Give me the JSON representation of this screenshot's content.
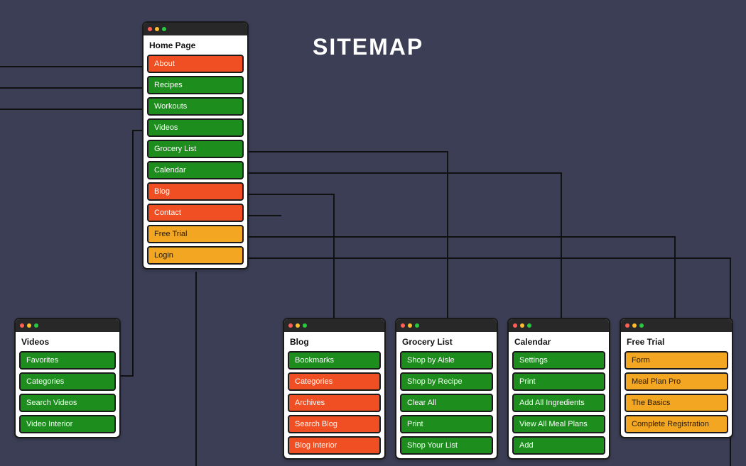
{
  "title": "SITEMAP",
  "colors": {
    "green": "#1d8e1d",
    "orange": "#f04e23",
    "amber": "#f3a621"
  },
  "cards": {
    "home": {
      "header": "Home Page",
      "items": [
        {
          "label": "About",
          "color": "orange"
        },
        {
          "label": "Recipes",
          "color": "green"
        },
        {
          "label": "Workouts",
          "color": "green"
        },
        {
          "label": "Videos",
          "color": "green"
        },
        {
          "label": "Grocery List",
          "color": "green"
        },
        {
          "label": "Calendar",
          "color": "green"
        },
        {
          "label": "Blog",
          "color": "orange"
        },
        {
          "label": "Contact",
          "color": "orange"
        },
        {
          "label": "Free Trial",
          "color": "amber"
        },
        {
          "label": "Login",
          "color": "amber"
        }
      ]
    },
    "videos": {
      "header": "Videos",
      "items": [
        {
          "label": "Favorites",
          "color": "green"
        },
        {
          "label": "Categories",
          "color": "green"
        },
        {
          "label": "Search Videos",
          "color": "green"
        },
        {
          "label": "Video Interior",
          "color": "green"
        }
      ]
    },
    "blog": {
      "header": "Blog",
      "items": [
        {
          "label": "Bookmarks",
          "color": "green"
        },
        {
          "label": "Categories",
          "color": "orange"
        },
        {
          "label": "Archives",
          "color": "orange"
        },
        {
          "label": "Search Blog",
          "color": "orange"
        },
        {
          "label": "Blog Interior",
          "color": "orange"
        }
      ]
    },
    "grocery": {
      "header": "Grocery List",
      "items": [
        {
          "label": "Shop by Aisle",
          "color": "green"
        },
        {
          "label": "Shop by Recipe",
          "color": "green"
        },
        {
          "label": "Clear All",
          "color": "green"
        },
        {
          "label": "Print",
          "color": "green"
        },
        {
          "label": "Shop Your List",
          "color": "green"
        }
      ]
    },
    "calendar": {
      "header": "Calendar",
      "items": [
        {
          "label": "Settings",
          "color": "green"
        },
        {
          "label": "Print",
          "color": "green"
        },
        {
          "label": "Add All Ingredients",
          "color": "green"
        },
        {
          "label": "View All Meal Plans",
          "color": "green"
        },
        {
          "label": "Add",
          "color": "green"
        }
      ]
    },
    "freetrial": {
      "header": "Free Trial",
      "items": [
        {
          "label": "Form",
          "color": "amber"
        },
        {
          "label": "Meal Plan Pro",
          "color": "amber"
        },
        {
          "label": "The Basics",
          "color": "amber"
        },
        {
          "label": "Complete Registration",
          "color": "amber"
        }
      ]
    }
  }
}
